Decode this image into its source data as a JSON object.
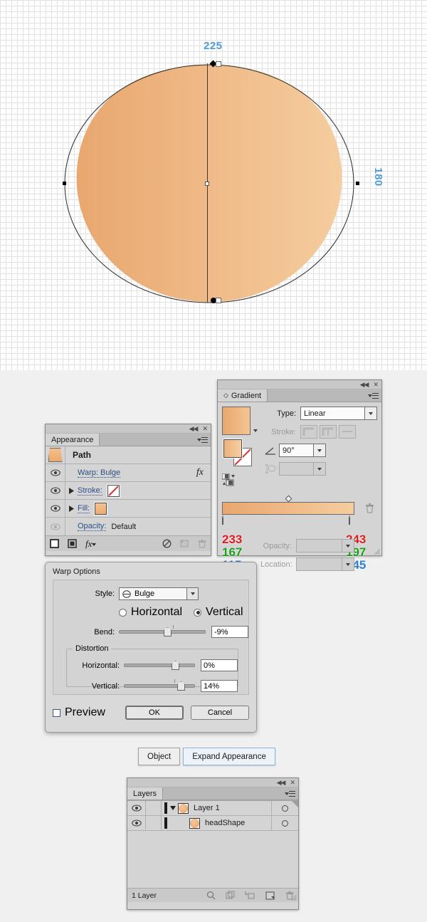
{
  "canvas": {
    "measure_width": "225",
    "measure_height": "180",
    "measure_color": "#4f9ad6",
    "shape_name": "headShape",
    "fill_start": "#e9a76f",
    "fill_end": "#f5cd9f"
  },
  "gradient_panel": {
    "title": "Gradient",
    "collapse_icon": "collapse-icon",
    "close_icon": "close-icon",
    "menu_icon": "panel-menu-icon",
    "type_label": "Type:",
    "type_value": "Linear",
    "stroke_label": "Stroke:",
    "angle_label": "angle-icon",
    "angle_value": "90°",
    "aspect_label": "aspect-ratio-icon",
    "aspect_value": "",
    "opacity_label": "Opacity:",
    "opacity_value": "",
    "location_label": "Location:",
    "location_value": "",
    "stops": [
      {
        "name": "left-stop",
        "r": "233",
        "g": "167",
        "b": "115",
        "color": "#e9a773"
      },
      {
        "name": "right-stop",
        "r": "243",
        "g": "197",
        "b": "145",
        "color": "#f3c591"
      }
    ]
  },
  "appearance_panel": {
    "title": "Appearance",
    "collapse_icon": "collapse-icon",
    "close_icon": "close-icon",
    "menu_icon": "panel-menu-icon",
    "object_name": "Path",
    "rows": [
      {
        "label": "Warp: Bulge",
        "fx": "fx"
      },
      {
        "label": "Stroke:"
      },
      {
        "label": "Fill:"
      },
      {
        "label": "Opacity:",
        "value": "Default"
      }
    ],
    "footer_icons": [
      "add-new-stroke-icon",
      "add-new-fill-icon",
      "add-new-effect-icon",
      "clear-appearance-icon",
      "duplicate-item-icon",
      "delete-item-icon"
    ]
  },
  "warp_dialog": {
    "title": "Warp Options",
    "style_label": "Style:",
    "style_value": "Bulge",
    "orientation": {
      "horizontal_label": "Horizontal",
      "vertical_label": "Vertical",
      "selected": "Vertical"
    },
    "bend_label": "Bend:",
    "bend_value": "-9%",
    "distortion_legend": "Distortion",
    "horizontal_label": "Horizontal:",
    "horizontal_value": "0%",
    "vertical_label": "Vertical:",
    "vertical_value": "14%",
    "preview_label": "Preview",
    "preview_checked": false,
    "ok_label": "OK",
    "cancel_label": "Cancel"
  },
  "object_bar": {
    "object_label": "Object",
    "expand_label": "Expand Appearance"
  },
  "layers_panel": {
    "title": "Layers",
    "collapse_icon": "collapse-icon",
    "close_icon": "close-icon",
    "menu_icon": "panel-menu-icon",
    "rows": [
      {
        "name": "Layer 1",
        "indent": 0,
        "has_twirl": true
      },
      {
        "name": "headShape",
        "indent": 1,
        "has_twirl": false
      }
    ],
    "status": "1 Layer",
    "footer_icons": [
      "locate-object-icon",
      "make-clipping-mask-icon",
      "create-sublayer-icon",
      "create-new-layer-icon",
      "delete-layer-icon"
    ]
  }
}
